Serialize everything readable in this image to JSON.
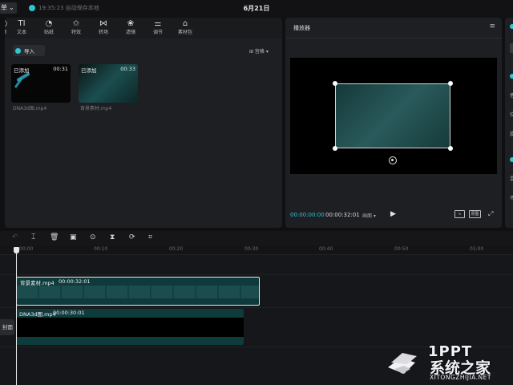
{
  "topbar": {
    "menu_label": "单",
    "menu_chevron": "chevron-down-icon",
    "save_status": "19:35:23 自动保存本地",
    "title": "6月21日"
  },
  "media_toolbar": [
    {
      "icon": "media-icon",
      "glyph": "◴",
      "label": "频"
    },
    {
      "icon": "text-icon",
      "glyph": "TI",
      "label": "文本"
    },
    {
      "icon": "sticker-icon",
      "glyph": "◔",
      "label": "贴纸"
    },
    {
      "icon": "effects-icon",
      "glyph": "✩",
      "label": "特效"
    },
    {
      "icon": "transition-icon",
      "glyph": "⋈",
      "label": "转场"
    },
    {
      "icon": "filter-icon",
      "glyph": "❀",
      "label": "滤镜"
    },
    {
      "icon": "adjust-icon",
      "glyph": "⚌",
      "label": "调节"
    },
    {
      "icon": "material-pack-icon",
      "glyph": "⌂",
      "label": "素材包"
    }
  ],
  "media": {
    "import_label": "导入",
    "sort_label": "⊞ 宫格 ▾",
    "items": [
      {
        "badge": "已添加",
        "duration": "00:31",
        "filename": "DNA3d图.mp4"
      },
      {
        "badge": "已添加",
        "duration": "00:33",
        "filename": "背景素材.mp4"
      }
    ]
  },
  "player": {
    "title": "播放器",
    "menu": "≡",
    "current_time": "00:00:00:00",
    "total_time": "00:00:32:01",
    "ratio_label": "画面 ▾",
    "play_glyph": "▶",
    "wave_label": "∿",
    "original_label": "原图",
    "fullscreen_glyph": "⤢"
  },
  "right_panel": {
    "items": [
      "色",
      "位",
      "旋",
      "混",
      "不"
    ]
  },
  "timeline": {
    "tools": [
      {
        "name": "undo-icon",
        "glyph": "↶",
        "disabled": true
      },
      {
        "name": "split-icon",
        "glyph": "⌶",
        "disabled": false
      },
      {
        "name": "delete-icon",
        "glyph": "🗑",
        "disabled": false
      },
      {
        "name": "freeze-icon",
        "glyph": "▣",
        "disabled": false
      },
      {
        "name": "reverse-icon",
        "glyph": "⊙",
        "disabled": false
      },
      {
        "name": "mirror-icon",
        "glyph": "⧗",
        "disabled": false
      },
      {
        "name": "rotate-icon",
        "glyph": "⟳",
        "disabled": false
      },
      {
        "name": "crop-icon",
        "glyph": "⌗",
        "disabled": false
      }
    ],
    "ticks": [
      "00:00",
      "00:10",
      "00:20",
      "00:30",
      "00:40",
      "00:50",
      "01:00"
    ],
    "clips": [
      {
        "name": "背景素材.mp4",
        "duration": "00:00:32:01"
      },
      {
        "name": "DNA3d图.mp4",
        "duration": "00:00:30:01"
      }
    ],
    "cover_label": "封面"
  },
  "watermark": {
    "title": "系统之家",
    "logo_text": "1PPT",
    "url": "XITONGZHIJIA.NET"
  },
  "colors": {
    "accent": "#2dc2cf",
    "panel": "#1e1f22",
    "background": "#101012"
  }
}
